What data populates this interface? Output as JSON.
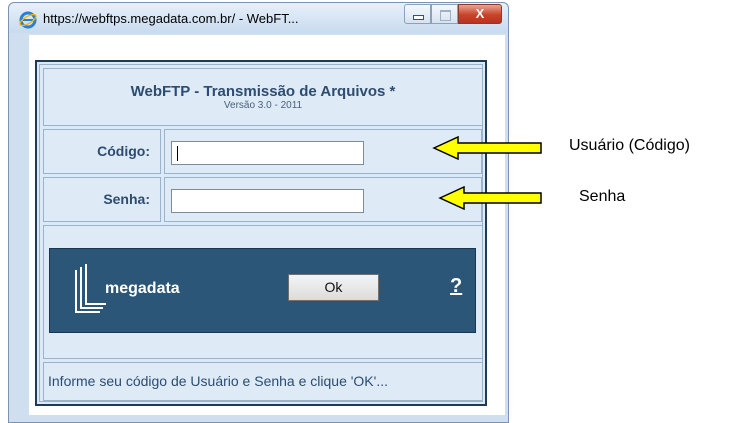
{
  "window": {
    "title": "https://webftps.megadata.com.br/ - WebFT...",
    "close_label": "X"
  },
  "header": {
    "title": "WebFTP - Transmissão de Arquivos *",
    "subtitle": "Versão 3.0 - 2011"
  },
  "form": {
    "code_label": "Código:",
    "code_value": "",
    "password_label": "Senha:",
    "password_value": ""
  },
  "banner": {
    "brand": "megadata",
    "ok_label": "Ok",
    "help_label": "?"
  },
  "footer": {
    "message": "Informe seu código de Usuário e Senha e clique 'OK'..."
  },
  "annotations": {
    "user_label": "Usuário (Código)",
    "password_label": "Senha"
  },
  "colors": {
    "banner": "#2c5677",
    "label_text": "#2d4c6f",
    "arrow_fill": "#ffff00"
  }
}
